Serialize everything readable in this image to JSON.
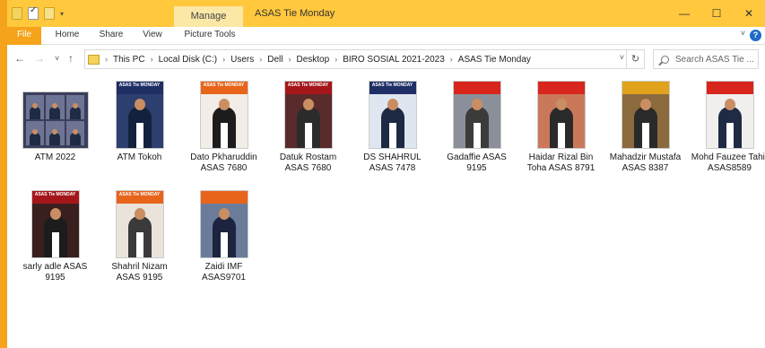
{
  "window": {
    "title": "ASAS Tie Monday",
    "manage_tab": "Manage",
    "controls": {
      "minimize": "—",
      "maximize": "☐",
      "close": "✕"
    }
  },
  "ribbon": {
    "tabs": [
      "File",
      "Home",
      "Share",
      "View",
      "Picture Tools"
    ],
    "help": "?"
  },
  "nav": {
    "back": "←",
    "forward": "→",
    "recent": "˅",
    "up": "↑"
  },
  "address": {
    "crumbs": [
      "This PC",
      "Local Disk (C:)",
      "Users",
      "Dell",
      "Desktop",
      "BIRO SOSIAL 2021-2023",
      "ASAS Tie Monday"
    ],
    "separator": "›",
    "dropdown": "˅",
    "refresh": "↻"
  },
  "search": {
    "placeholder": "Search ASAS Tie ..."
  },
  "colors": {
    "accent": "#f5a31a",
    "titlebar": "#ffc83d",
    "manage": "#fbe7a6"
  },
  "files": [
    {
      "label": "ATM 2022",
      "kind": "collage"
    },
    {
      "label": "ATM Tokoh",
      "kind": "poster",
      "band": "ASAS Tie MONDAY",
      "bandColor": "#1f2f66",
      "bg": "#2d3f6f",
      "suit": "#14213d"
    },
    {
      "label": "Dato Pkharuddin ASAS 7680",
      "kind": "poster",
      "band": "ASAS Tie MONDAY",
      "bandColor": "#e8641b",
      "bg": "#f2ede6",
      "suit": "#1c1c1c"
    },
    {
      "label": "Datuk Rostam ASAS 7680",
      "kind": "poster",
      "band": "ASAS Tie MONDAY",
      "bandColor": "#a5161a",
      "bg": "#5a2b2b",
      "suit": "#2b2b2b"
    },
    {
      "label": "DS SHAHRUL ASAS 7478",
      "kind": "poster",
      "band": "ASAS Tie MONDAY",
      "bandColor": "#1f2f66",
      "bg": "#dfe6ef",
      "suit": "#1e2a44"
    },
    {
      "label": "Gadaffie ASAS 9195",
      "kind": "poster",
      "band": "",
      "bandColor": "#d8261c",
      "bg": "#8a8f99",
      "suit": "#3b3b3b"
    },
    {
      "label": "Haidar Rizal Bin Toha ASAS 8791",
      "kind": "poster",
      "band": "",
      "bandColor": "#d8261c",
      "bg": "#c9795a",
      "suit": "#2a2a2a"
    },
    {
      "label": "Mahadzir Mustafa ASAS 8387",
      "kind": "poster",
      "band": "",
      "bandColor": "#e1a21c",
      "bg": "#8b6a3d",
      "suit": "#2a2a2a"
    },
    {
      "label": "Mohd Fauzee Tahir ASAS8589",
      "kind": "poster",
      "band": "",
      "bandColor": "#d8261c",
      "bg": "#f0efed",
      "suit": "#1f2a44"
    },
    {
      "label": "sarly adle ASAS 9195",
      "kind": "poster",
      "band": "ASAS Tie MONDAY",
      "bandColor": "#a5161a",
      "bg": "#3a1f1f",
      "suit": "#1c1c1c"
    },
    {
      "label": "Shahril Nizam ASAS 9195",
      "kind": "poster",
      "band": "ASAS Tie MONDAY",
      "bandColor": "#e8641b",
      "bg": "#e9e3da",
      "suit": "#3a3a3a"
    },
    {
      "label": "Zaidi IMF ASAS9701",
      "kind": "poster",
      "band": "",
      "bandColor": "#e8641b",
      "bg": "#6b7c9a",
      "suit": "#1c2440"
    }
  ]
}
